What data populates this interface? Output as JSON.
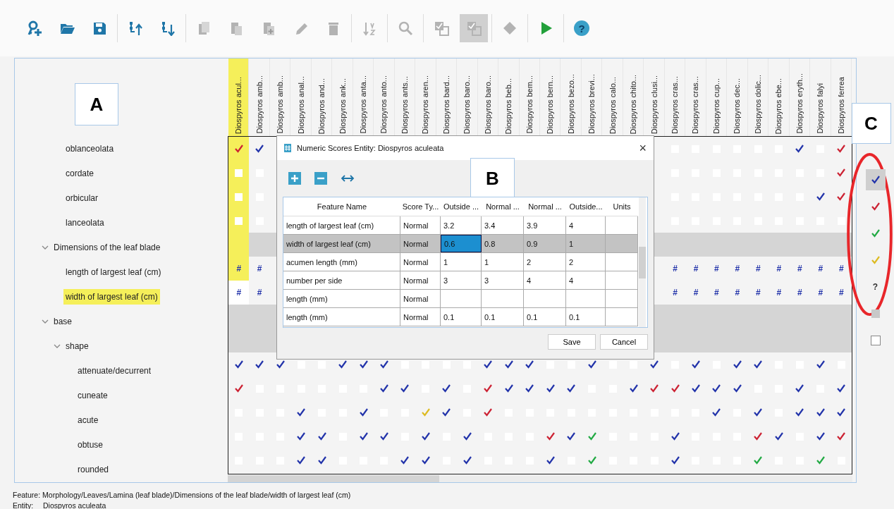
{
  "toolbar": [
    {
      "kind": "add-key",
      "disabled": false,
      "pressed": false
    },
    {
      "kind": "folder",
      "disabled": false,
      "pressed": false
    },
    {
      "kind": "save",
      "disabled": false,
      "pressed": false
    },
    {
      "kind": "separator"
    },
    {
      "kind": "move-up",
      "disabled": false,
      "pressed": false
    },
    {
      "kind": "move-down",
      "disabled": false,
      "pressed": false
    },
    {
      "kind": "separator"
    },
    {
      "kind": "copy",
      "disabled": true,
      "pressed": false
    },
    {
      "kind": "paste",
      "disabled": true,
      "pressed": false
    },
    {
      "kind": "paste-add",
      "disabled": true,
      "pressed": false
    },
    {
      "kind": "pencil",
      "disabled": true,
      "pressed": false
    },
    {
      "kind": "trash",
      "disabled": true,
      "pressed": false
    },
    {
      "kind": "separator"
    },
    {
      "kind": "sort",
      "disabled": true,
      "pressed": false
    },
    {
      "kind": "separator"
    },
    {
      "kind": "search",
      "disabled": true,
      "pressed": false
    },
    {
      "kind": "separator"
    },
    {
      "kind": "check-squares",
      "disabled": true,
      "pressed": false
    },
    {
      "kind": "check-squares",
      "disabled": true,
      "pressed": true
    },
    {
      "kind": "separator"
    },
    {
      "kind": "diamond",
      "disabled": true,
      "pressed": false
    },
    {
      "kind": "separator"
    },
    {
      "kind": "play",
      "disabled": false,
      "pressed": false
    },
    {
      "kind": "separator"
    },
    {
      "kind": "help",
      "label": "?",
      "disabled": false,
      "pressed": false
    }
  ],
  "annotations": {
    "a": "A",
    "b": "B",
    "c": "C"
  },
  "columns": [
    {
      "label": "Diospyros acul...",
      "selected": true
    },
    {
      "label": "Diospyros amb...",
      "selected": false
    },
    {
      "label": "Diospyros amb...",
      "selected": false
    },
    {
      "label": "Diospyros anal...",
      "selected": false
    },
    {
      "label": "Diospyros and...",
      "selected": false
    },
    {
      "label": "Diospyros ank...",
      "selected": false
    },
    {
      "label": "Diospyros anta...",
      "selected": false
    },
    {
      "label": "Diospyros anto...",
      "selected": false
    },
    {
      "label": "Diospyros ants...",
      "selected": false
    },
    {
      "label": "Diospyros aren...",
      "selected": false
    },
    {
      "label": "Diospyros bard...",
      "selected": false
    },
    {
      "label": "Diospyros baro...",
      "selected": false
    },
    {
      "label": "Diospyros baro...",
      "selected": false
    },
    {
      "label": "Diospyros beb...",
      "selected": false
    },
    {
      "label": "Diospyros bem...",
      "selected": false
    },
    {
      "label": "Diospyros bern...",
      "selected": false
    },
    {
      "label": "Diospyros bezo...",
      "selected": false
    },
    {
      "label": "Diospyros brevi...",
      "selected": false
    },
    {
      "label": "Diospyros calo...",
      "selected": false
    },
    {
      "label": "Diospyros chito...",
      "selected": false
    },
    {
      "label": "Diospyros clusi...",
      "selected": false
    },
    {
      "label": "Diospyros cras...",
      "selected": false
    },
    {
      "label": "Diospyros cras...",
      "selected": false
    },
    {
      "label": "Diospyros cup...",
      "selected": false
    },
    {
      "label": "Diospyros dec...",
      "selected": false
    },
    {
      "label": "Diospyros dolic...",
      "selected": false
    },
    {
      "label": "Diospyros ebe...",
      "selected": false
    },
    {
      "label": "Diospyros eryth...",
      "selected": false
    },
    {
      "label": "Diospyros falyi",
      "selected": false
    },
    {
      "label": "Diospyros ferrea",
      "selected": false
    }
  ],
  "tree": [
    {
      "children": [
        {
          "label": "oblanceolata",
          "selected": false,
          "cells": [
            {
              "kind": "check",
              "color": "#cc2233"
            },
            {
              "kind": "check",
              "color": "#2233aa"
            },
            null,
            null,
            null,
            null,
            null,
            null,
            null,
            null,
            null,
            null,
            null,
            null,
            null,
            null,
            null,
            null,
            null,
            null,
            null,
            {
              "kind": "empty"
            },
            {
              "kind": "empty"
            },
            {
              "kind": "empty"
            },
            {
              "kind": "empty"
            },
            {
              "kind": "empty"
            },
            {
              "kind": "empty"
            },
            {
              "kind": "check",
              "color": "#2233aa"
            },
            {
              "kind": "empty"
            },
            {
              "kind": "check",
              "color": "#cc2233"
            }
          ]
        },
        {
          "label": "cordate",
          "selected": false,
          "cells": [
            {
              "kind": "empty"
            },
            {
              "kind": "empty"
            },
            null,
            null,
            null,
            null,
            null,
            null,
            null,
            null,
            null,
            null,
            null,
            null,
            null,
            null,
            null,
            null,
            null,
            null,
            null,
            {
              "kind": "empty"
            },
            {
              "kind": "empty"
            },
            {
              "kind": "empty"
            },
            {
              "kind": "empty"
            },
            {
              "kind": "empty"
            },
            {
              "kind": "empty"
            },
            {
              "kind": "empty"
            },
            {
              "kind": "empty"
            },
            {
              "kind": "check",
              "color": "#cc2233"
            }
          ]
        },
        {
          "label": "orbicular",
          "selected": false,
          "cells": [
            {
              "kind": "empty"
            },
            {
              "kind": "empty"
            },
            null,
            null,
            null,
            null,
            null,
            null,
            null,
            null,
            null,
            null,
            null,
            null,
            null,
            null,
            null,
            null,
            null,
            null,
            null,
            {
              "kind": "empty"
            },
            {
              "kind": "empty"
            },
            {
              "kind": "empty"
            },
            {
              "kind": "empty"
            },
            {
              "kind": "empty"
            },
            {
              "kind": "empty"
            },
            {
              "kind": "empty"
            },
            {
              "kind": "check",
              "color": "#2233aa"
            },
            {
              "kind": "check",
              "color": "#cc2233"
            }
          ]
        },
        {
          "label": "lanceolata",
          "selected": false,
          "cells": [
            {
              "kind": "empty"
            },
            {
              "kind": "empty"
            },
            null,
            null,
            null,
            null,
            null,
            null,
            null,
            null,
            null,
            null,
            null,
            null,
            null,
            null,
            null,
            null,
            null,
            null,
            null,
            {
              "kind": "empty"
            },
            {
              "kind": "empty"
            },
            {
              "kind": "empty"
            },
            {
              "kind": "empty"
            },
            {
              "kind": "empty"
            },
            {
              "kind": "empty"
            },
            {
              "kind": "empty"
            },
            {
              "kind": "empty"
            },
            {
              "kind": "empty"
            }
          ]
        }
      ]
    },
    {
      "label": "Dimensions of the leaf blade",
      "selected": false,
      "expanded": true,
      "children": [
        {
          "label": "length of largest leaf (cm)",
          "selected": false,
          "cells": [
            {
              "kind": "number",
              "text": "#"
            },
            {
              "kind": "number",
              "text": "#"
            },
            null,
            null,
            null,
            null,
            null,
            null,
            null,
            null,
            null,
            null,
            null,
            null,
            null,
            null,
            null,
            null,
            null,
            null,
            null,
            {
              "kind": "number",
              "text": "#"
            },
            {
              "kind": "number",
              "text": "#"
            },
            {
              "kind": "number",
              "text": "#"
            },
            {
              "kind": "number",
              "text": "#"
            },
            {
              "kind": "number",
              "text": "#"
            },
            {
              "kind": "number",
              "text": "#"
            },
            {
              "kind": "number",
              "text": "#"
            },
            {
              "kind": "number",
              "text": "#"
            },
            {
              "kind": "number",
              "text": "#"
            }
          ]
        },
        {
          "label": "width of largest leaf (cm)",
          "selected": true,
          "cells": [
            {
              "kind": "number",
              "text": "#"
            },
            {
              "kind": "number",
              "text": "#"
            },
            null,
            null,
            null,
            null,
            null,
            null,
            null,
            null,
            null,
            null,
            null,
            null,
            null,
            null,
            null,
            null,
            null,
            null,
            null,
            {
              "kind": "number",
              "text": "#"
            },
            {
              "kind": "number",
              "text": "#"
            },
            {
              "kind": "number",
              "text": "#"
            },
            {
              "kind": "number",
              "text": "#"
            },
            {
              "kind": "number",
              "text": "#"
            },
            {
              "kind": "number",
              "text": "#"
            },
            {
              "kind": "number",
              "text": "#"
            },
            {
              "kind": "number",
              "text": "#"
            },
            {
              "kind": "number",
              "text": "#"
            }
          ]
        }
      ]
    },
    {
      "label": "base",
      "selected": false,
      "expanded": true,
      "children": [
        {
          "label": "shape",
          "selected": false,
          "expanded": true,
          "children": [
            {
              "label": "attenuate/decurrent",
              "selected": false,
              "cells": [
                {
                  "kind": "check",
                  "color": "#2233aa"
                },
                {
                  "kind": "check",
                  "color": "#2233aa"
                },
                {
                  "kind": "check",
                  "color": "#2233aa"
                },
                {
                  "kind": "empty"
                },
                {
                  "kind": "empty"
                },
                {
                  "kind": "check",
                  "color": "#2233aa"
                },
                {
                  "kind": "check",
                  "color": "#2233aa"
                },
                {
                  "kind": "check",
                  "color": "#2233aa"
                },
                {
                  "kind": "empty"
                },
                {
                  "kind": "empty"
                },
                {
                  "kind": "empty"
                },
                {
                  "kind": "empty"
                },
                {
                  "kind": "check",
                  "color": "#2233aa"
                },
                {
                  "kind": "check",
                  "color": "#2233aa"
                },
                {
                  "kind": "check",
                  "color": "#2233aa"
                },
                {
                  "kind": "empty"
                },
                {
                  "kind": "empty"
                },
                {
                  "kind": "check",
                  "color": "#2233aa"
                },
                {
                  "kind": "empty"
                },
                {
                  "kind": "empty"
                },
                {
                  "kind": "check",
                  "color": "#2233aa"
                },
                {
                  "kind": "empty"
                },
                {
                  "kind": "check",
                  "color": "#2233aa"
                },
                {
                  "kind": "empty"
                },
                {
                  "kind": "check",
                  "color": "#2233aa"
                },
                {
                  "kind": "check",
                  "color": "#2233aa"
                },
                {
                  "kind": "empty"
                },
                {
                  "kind": "empty"
                },
                {
                  "kind": "check",
                  "color": "#2233aa"
                },
                {
                  "kind": "empty"
                }
              ]
            },
            {
              "label": "cuneate",
              "selected": false,
              "cells": [
                {
                  "kind": "check",
                  "color": "#cc2233"
                },
                {
                  "kind": "empty"
                },
                {
                  "kind": "empty"
                },
                {
                  "kind": "empty"
                },
                {
                  "kind": "empty"
                },
                {
                  "kind": "empty"
                },
                {
                  "kind": "empty"
                },
                {
                  "kind": "check",
                  "color": "#2233aa"
                },
                {
                  "kind": "check",
                  "color": "#2233aa"
                },
                {
                  "kind": "empty"
                },
                {
                  "kind": "check",
                  "color": "#2233aa"
                },
                {
                  "kind": "empty"
                },
                {
                  "kind": "check",
                  "color": "#cc2233"
                },
                {
                  "kind": "check",
                  "color": "#2233aa"
                },
                {
                  "kind": "check",
                  "color": "#2233aa"
                },
                {
                  "kind": "check",
                  "color": "#2233aa"
                },
                {
                  "kind": "check",
                  "color": "#2233aa"
                },
                {
                  "kind": "empty"
                },
                {
                  "kind": "empty"
                },
                {
                  "kind": "check",
                  "color": "#2233aa"
                },
                {
                  "kind": "check",
                  "color": "#cc2233"
                },
                {
                  "kind": "check",
                  "color": "#cc2233"
                },
                {
                  "kind": "check",
                  "color": "#2233aa"
                },
                {
                  "kind": "check",
                  "color": "#2233aa"
                },
                {
                  "kind": "check",
                  "color": "#2233aa"
                },
                {
                  "kind": "empty"
                },
                {
                  "kind": "empty"
                },
                {
                  "kind": "check",
                  "color": "#2233aa"
                },
                {
                  "kind": "empty"
                },
                {
                  "kind": "check",
                  "color": "#2233aa"
                }
              ]
            },
            {
              "label": "acute",
              "selected": false,
              "cells": [
                {
                  "kind": "empty"
                },
                {
                  "kind": "empty"
                },
                {
                  "kind": "empty"
                },
                {
                  "kind": "check",
                  "color": "#2233aa"
                },
                {
                  "kind": "empty"
                },
                {
                  "kind": "empty"
                },
                {
                  "kind": "check",
                  "color": "#2233aa"
                },
                {
                  "kind": "empty"
                },
                {
                  "kind": "empty"
                },
                {
                  "kind": "check",
                  "color": "#ddbb22"
                },
                {
                  "kind": "check",
                  "color": "#2233aa"
                },
                {
                  "kind": "empty"
                },
                {
                  "kind": "check",
                  "color": "#cc2233"
                },
                {
                  "kind": "empty"
                },
                {
                  "kind": "empty"
                },
                {
                  "kind": "empty"
                },
                {
                  "kind": "empty"
                },
                {
                  "kind": "empty"
                },
                {
                  "kind": "empty"
                },
                {
                  "kind": "empty"
                },
                {
                  "kind": "empty"
                },
                {
                  "kind": "empty"
                },
                {
                  "kind": "empty"
                },
                {
                  "kind": "check",
                  "color": "#2233aa"
                },
                {
                  "kind": "empty"
                },
                {
                  "kind": "check",
                  "color": "#2233aa"
                },
                {
                  "kind": "empty"
                },
                {
                  "kind": "check",
                  "color": "#2233aa"
                },
                {
                  "kind": "check",
                  "color": "#2233aa"
                },
                {
                  "kind": "check",
                  "color": "#2233aa"
                }
              ]
            },
            {
              "label": "obtuse",
              "selected": false,
              "cells": [
                {
                  "kind": "empty"
                },
                {
                  "kind": "empty"
                },
                {
                  "kind": "empty"
                },
                {
                  "kind": "check",
                  "color": "#2233aa"
                },
                {
                  "kind": "check",
                  "color": "#2233aa"
                },
                {
                  "kind": "empty"
                },
                {
                  "kind": "check",
                  "color": "#2233aa"
                },
                {
                  "kind": "check",
                  "color": "#2233aa"
                },
                {
                  "kind": "empty"
                },
                {
                  "kind": "check",
                  "color": "#2233aa"
                },
                {
                  "kind": "empty"
                },
                {
                  "kind": "check",
                  "color": "#2233aa"
                },
                {
                  "kind": "empty"
                },
                {
                  "kind": "empty"
                },
                {
                  "kind": "empty"
                },
                {
                  "kind": "check",
                  "color": "#cc2233"
                },
                {
                  "kind": "check",
                  "color": "#2233aa"
                },
                {
                  "kind": "check",
                  "color": "#22aa44"
                },
                {
                  "kind": "empty"
                },
                {
                  "kind": "empty"
                },
                {
                  "kind": "empty"
                },
                {
                  "kind": "check",
                  "color": "#2233aa"
                },
                {
                  "kind": "empty"
                },
                {
                  "kind": "empty"
                },
                {
                  "kind": "empty"
                },
                {
                  "kind": "check",
                  "color": "#cc2233"
                },
                {
                  "kind": "check",
                  "color": "#2233aa"
                },
                {
                  "kind": "empty"
                },
                {
                  "kind": "check",
                  "color": "#2233aa"
                },
                {
                  "kind": "check",
                  "color": "#cc2233"
                }
              ]
            },
            {
              "label": "rounded",
              "selected": false,
              "cells": [
                {
                  "kind": "empty"
                },
                {
                  "kind": "empty"
                },
                {
                  "kind": "empty"
                },
                {
                  "kind": "check",
                  "color": "#2233aa"
                },
                {
                  "kind": "check",
                  "color": "#2233aa"
                },
                {
                  "kind": "empty"
                },
                {
                  "kind": "empty"
                },
                {
                  "kind": "empty"
                },
                {
                  "kind": "check",
                  "color": "#2233aa"
                },
                {
                  "kind": "check",
                  "color": "#2233aa"
                },
                {
                  "kind": "empty"
                },
                {
                  "kind": "check",
                  "color": "#2233aa"
                },
                {
                  "kind": "empty"
                },
                {
                  "kind": "empty"
                },
                {
                  "kind": "empty"
                },
                {
                  "kind": "check",
                  "color": "#2233aa"
                },
                {
                  "kind": "empty"
                },
                {
                  "kind": "check",
                  "color": "#22aa44"
                },
                {
                  "kind": "empty"
                },
                {
                  "kind": "empty"
                },
                {
                  "kind": "empty"
                },
                {
                  "kind": "check",
                  "color": "#2233aa"
                },
                {
                  "kind": "empty"
                },
                {
                  "kind": "empty"
                },
                {
                  "kind": "empty"
                },
                {
                  "kind": "check",
                  "color": "#22aa44"
                },
                {
                  "kind": "empty"
                },
                {
                  "kind": "empty"
                },
                {
                  "kind": "check",
                  "color": "#22aa44"
                },
                {
                  "kind": "empty"
                }
              ]
            }
          ]
        }
      ]
    }
  ],
  "dialog": {
    "title": "Numeric Scores Entity: Diospyros aculeata",
    "close": "×",
    "columns": [
      "Feature Name",
      "Score Ty...",
      "Outside ...",
      "Normal ...",
      "Normal ...",
      "Outside...",
      "Units"
    ],
    "rows": [
      {
        "selected": false,
        "cells": [
          {
            "text": "length of largest leaf (cm)",
            "focused": false
          },
          {
            "text": "Normal",
            "focused": false
          },
          {
            "text": "3.2",
            "focused": false
          },
          {
            "text": "3.4",
            "focused": false
          },
          {
            "text": "3.9",
            "focused": false
          },
          {
            "text": "4",
            "focused": false
          },
          null
        ]
      },
      {
        "selected": true,
        "cells": [
          {
            "text": "width of largest leaf (cm)",
            "focused": false
          },
          {
            "text": "Normal",
            "focused": false
          },
          {
            "text": "0.6",
            "focused": true
          },
          {
            "text": "0.8",
            "focused": false
          },
          {
            "text": "0.9",
            "focused": false
          },
          {
            "text": "1",
            "focused": false
          },
          null
        ]
      },
      {
        "selected": false,
        "cells": [
          {
            "text": "acumen length (mm)",
            "focused": false
          },
          {
            "text": "Normal",
            "focused": false
          },
          {
            "text": "1",
            "focused": false
          },
          {
            "text": "1",
            "focused": false
          },
          {
            "text": "2",
            "focused": false
          },
          {
            "text": "2",
            "focused": false
          },
          null
        ]
      },
      {
        "selected": false,
        "cells": [
          {
            "text": "number per side",
            "focused": false
          },
          {
            "text": "Normal",
            "focused": false
          },
          {
            "text": "3",
            "focused": false
          },
          {
            "text": "3",
            "focused": false
          },
          {
            "text": "4",
            "focused": false
          },
          {
            "text": "4",
            "focused": false
          },
          null
        ]
      },
      {
        "selected": false,
        "cells": [
          {
            "text": "length (mm)",
            "focused": false
          },
          {
            "text": "Normal",
            "focused": false
          },
          null,
          null,
          null,
          null,
          null
        ]
      },
      {
        "selected": false,
        "cells": [
          {
            "text": "length (mm)",
            "focused": false
          },
          {
            "text": "Normal",
            "focused": false
          },
          {
            "text": "0.1",
            "focused": false
          },
          {
            "text": "0.1",
            "focused": false
          },
          {
            "text": "0.1",
            "focused": false
          },
          {
            "text": "0.1",
            "focused": false
          },
          null
        ]
      }
    ],
    "buttons": [
      "Save",
      "Cancel"
    ]
  },
  "legend": [
    {
      "kind": "check",
      "color": "#2233aa",
      "selected": true
    },
    {
      "kind": "check",
      "color": "#cc2233",
      "selected": false
    },
    {
      "kind": "check",
      "color": "#22aa44",
      "selected": false
    },
    {
      "kind": "check",
      "color": "#ddbb22",
      "selected": false
    },
    {
      "kind": "text",
      "label": "?",
      "selected": false
    },
    {
      "kind": "gray-square",
      "selected": false
    },
    {
      "kind": "white-square",
      "selected": false
    }
  ],
  "status_bar": {
    "feature_label": "Feature:",
    "feature": "Morphology/Leaves/Lamina (leaf blade)/Dimensions of the leaf blade/width of largest leaf (cm)",
    "entity_label": "Entity:",
    "entity": "Diospyros aculeata"
  }
}
